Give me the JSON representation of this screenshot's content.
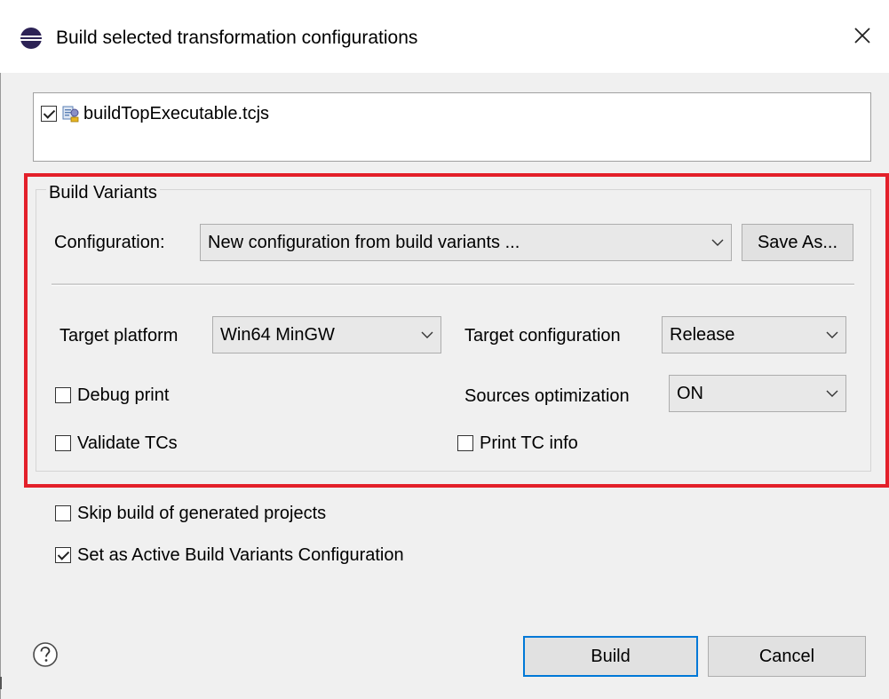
{
  "window": {
    "title": "Build selected transformation configurations",
    "app_icon": "eclipse-icon",
    "close_icon": "close-icon"
  },
  "file_list": {
    "items": [
      {
        "label": "buildTopExecutable.tcjs",
        "checked": true,
        "icon": "transformation-config-file-icon"
      }
    ]
  },
  "build_variants": {
    "group_title": "Build Variants",
    "highlight_color": "#e3202a",
    "configuration": {
      "label": "Configuration:",
      "value": "New configuration from build variants ...",
      "save_as_label": "Save As..."
    },
    "target_platform": {
      "label": "Target platform",
      "value": "Win64 MinGW"
    },
    "target_configuration": {
      "label": "Target configuration",
      "value": "Release"
    },
    "sources_optimization": {
      "label": "Sources optimization",
      "value": "ON"
    },
    "debug_print": {
      "label": "Debug print",
      "checked": false
    },
    "validate_tcs": {
      "label": "Validate TCs",
      "checked": false
    },
    "print_tc_info": {
      "label": "Print TC info",
      "checked": false
    }
  },
  "options": {
    "skip_build": {
      "label": "Skip build of generated projects",
      "checked": false
    },
    "set_active": {
      "label": "Set as Active Build Variants Configuration",
      "checked": true
    }
  },
  "footer": {
    "help_icon": "help-icon",
    "build_label": "Build",
    "cancel_label": "Cancel",
    "default_button_color": "#0078d7"
  }
}
